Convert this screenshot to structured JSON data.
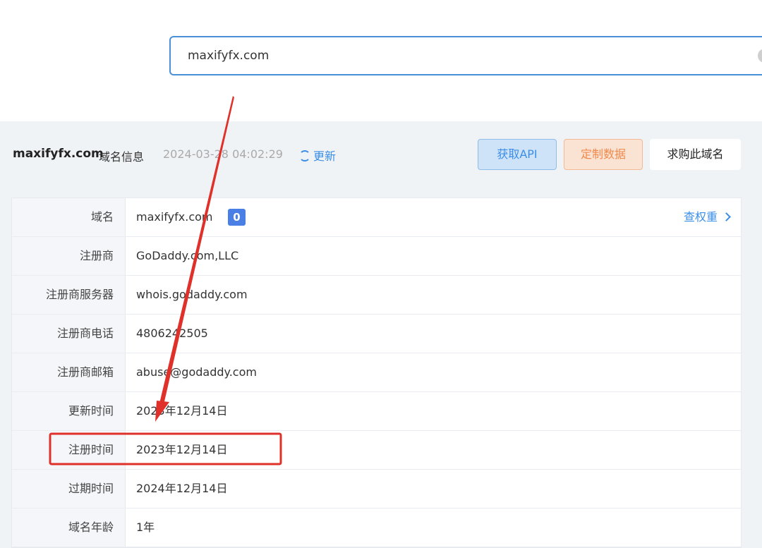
{
  "search": {
    "value": "maxifyfx.com"
  },
  "header": {
    "domain": "maxifyfx.com",
    "title_suffix": "域名信息",
    "timestamp": "2024-03-28 04:02:29",
    "refresh_label": "更新",
    "buttons": {
      "api_label": "获取API",
      "custom_label": "定制数据",
      "buy_label": "求购此域名"
    }
  },
  "info": {
    "rows": [
      {
        "label": "域名",
        "value": "maxifyfx.com",
        "badge": "0",
        "link_label": "查权重"
      },
      {
        "label": "注册商",
        "value": "GoDaddy.com,LLC"
      },
      {
        "label": "注册商服务器",
        "value": "whois.godaddy.com"
      },
      {
        "label": "注册商电话",
        "value": "4806242505"
      },
      {
        "label": "注册商邮箱",
        "value": "abuse@godaddy.com"
      },
      {
        "label": "更新时间",
        "value": "2023年12月14日"
      },
      {
        "label": "注册时间",
        "value": "2023年12月14日"
      },
      {
        "label": "过期时间",
        "value": "2024年12月14日"
      },
      {
        "label": "域名年龄",
        "value": "1年"
      }
    ]
  },
  "colors": {
    "accent": "#3a8ee6",
    "highlight_box": "#e0302a",
    "arrow": "#e0302a"
  }
}
